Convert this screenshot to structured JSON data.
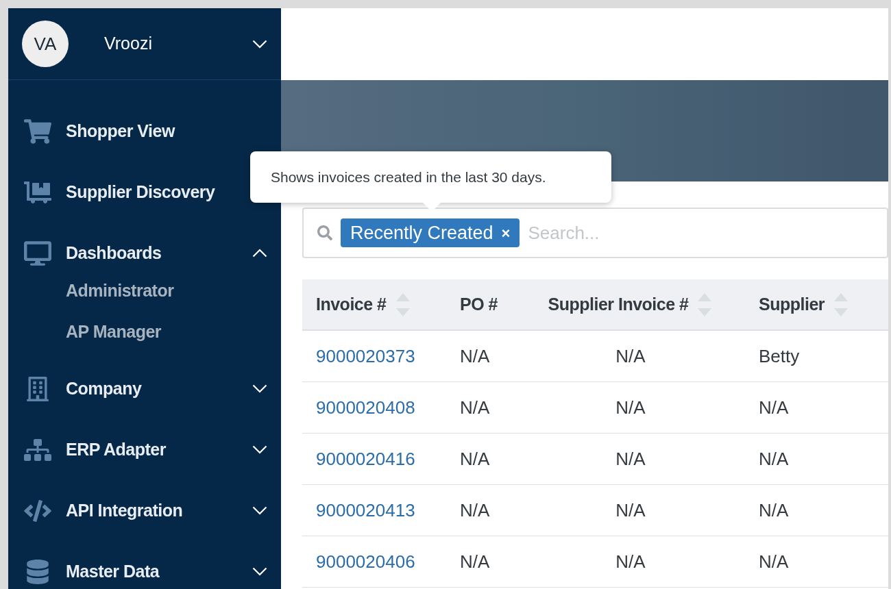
{
  "account": {
    "initials": "VA",
    "name": "Vroozi",
    "expanded": false
  },
  "sidebar": {
    "items": [
      {
        "label": "Shopper View"
      },
      {
        "label": "Supplier Discovery"
      },
      {
        "label": "Dashboards",
        "expanded": true,
        "children": [
          {
            "label": "Administrator"
          },
          {
            "label": "AP Manager"
          }
        ]
      },
      {
        "label": "Company",
        "expanded": false
      },
      {
        "label": "ERP Adapter",
        "expanded": false
      },
      {
        "label": "API Integration",
        "expanded": false
      },
      {
        "label": "Master Data",
        "expanded": false
      }
    ]
  },
  "tooltip": "Shows invoices created in the last 30 days.",
  "search": {
    "placeholder": "Search...",
    "filter_chip": {
      "label": "Recently Created",
      "remove": "×"
    }
  },
  "table": {
    "columns": [
      {
        "label": "Invoice #",
        "sortable": true
      },
      {
        "label": "PO #",
        "sortable": false
      },
      {
        "label": "Supplier Invoice #",
        "sortable": true
      },
      {
        "label": "Supplier",
        "sortable": true
      }
    ],
    "rows": [
      [
        "9000020373",
        "N/A",
        "N/A",
        "Betty"
      ],
      [
        "9000020408",
        "N/A",
        "N/A",
        "N/A"
      ],
      [
        "9000020416",
        "N/A",
        "N/A",
        "N/A"
      ],
      [
        "9000020413",
        "N/A",
        "N/A",
        "N/A"
      ],
      [
        "9000020406",
        "N/A",
        "N/A",
        "N/A"
      ]
    ]
  }
}
